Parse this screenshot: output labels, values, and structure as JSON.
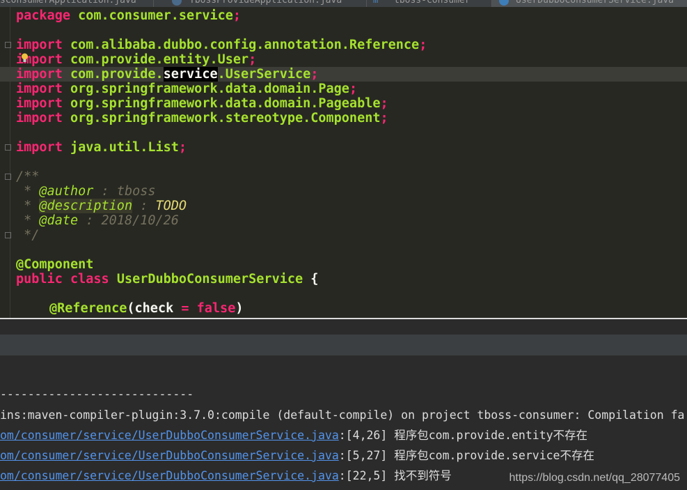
{
  "tabs": [
    {
      "label": "sConsumerApplication.java"
    },
    {
      "label": "TbossProvideApplication.java"
    },
    {
      "label": "tboss-consumer"
    },
    {
      "label": "UserDubboConsumerService.java"
    }
  ],
  "code": {
    "package_kw": "package",
    "package_name": "com.consumer.service",
    "import_kw": "import",
    "imports": [
      "com.alibaba.dubbo.config.annotation.Reference",
      "com.provide.entity.User",
      "com.provide.",
      "org.springframework.data.domain.Page",
      "org.springframework.data.domain.Pageable",
      "org.springframework.stereotype.Component",
      "java.util.List"
    ],
    "import3_hl": "service",
    "import3_tail": ".UserService",
    "semicolon": ";",
    "javadoc": {
      "open": "/**",
      "star": " * ",
      "author_tag": "@author",
      "author_val": " : tboss",
      "desc_tag": "@description",
      "desc_sep": " : ",
      "desc_val": "TODO",
      "date_tag": "@date",
      "date_val": " : 2018/10/26",
      "close": " */"
    },
    "annotation": "@Component",
    "public_kw": "public",
    "class_kw": "class",
    "class_name": "UserDubboConsumerService",
    "brace": " {",
    "ref_annotation": "@Reference",
    "ref_open": "(check ",
    "ref_eq": "=",
    "ref_false": "false",
    "ref_close": ")"
  },
  "console": {
    "separator": "----------------------------",
    "error_line": "ins:maven-compiler-plugin:3.7.0:compile (default-compile) on project tboss-consumer: Compilation fa",
    "errors": [
      {
        "link": "om/consumer/service/UserDubboConsumerService.java",
        "pos": ":[4,26]",
        "msg": " 程序包com.provide.entity不存在"
      },
      {
        "link": "om/consumer/service/UserDubboConsumerService.java",
        "pos": ":[5,27]",
        "msg": " 程序包com.provide.service不存在"
      },
      {
        "link": "om/consumer/service/UserDubboConsumerService.java",
        "pos": ":[22,5]",
        "msg": " 找不到符号"
      }
    ]
  },
  "watermark": "https://blog.csdn.net/qq_28077405",
  "colors": {
    "editor_bg": "#272822",
    "keyword": "#f92672",
    "identifier": "#a6e22e",
    "comment": "#75715e",
    "link": "#5394ec"
  }
}
